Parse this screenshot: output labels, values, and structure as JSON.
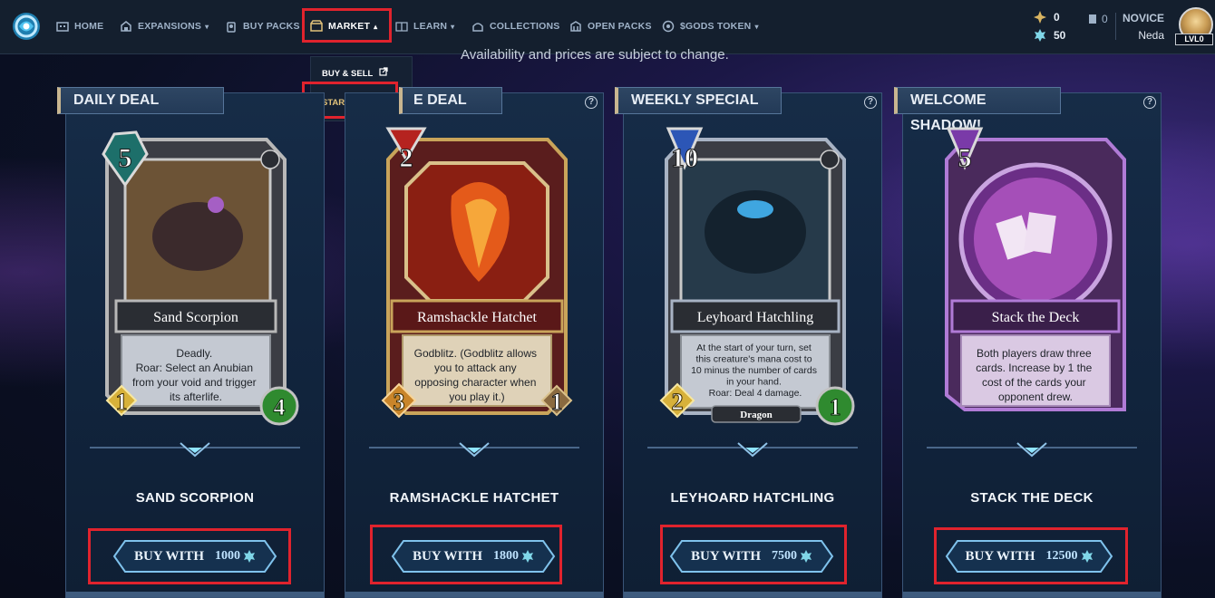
{
  "nav": {
    "items": [
      {
        "label": "HOME",
        "icon": "home-icon",
        "caret": ""
      },
      {
        "label": "EXPANSIONS",
        "icon": "expansions-icon",
        "caret": "▾"
      },
      {
        "label": "BUY PACKS",
        "icon": "buy-packs-icon",
        "caret": ""
      },
      {
        "label": "MARKET",
        "icon": "market-icon",
        "caret": "▴"
      },
      {
        "label": "LEARN",
        "icon": "learn-icon",
        "caret": "▾"
      },
      {
        "label": "COLLECTIONS",
        "icon": "collections-icon",
        "caret": ""
      },
      {
        "label": "OPEN PACKS",
        "icon": "open-packs-icon",
        "caret": ""
      },
      {
        "label": "$GODS TOKEN",
        "icon": "gods-token-icon",
        "caret": "▾"
      }
    ],
    "flux": "0",
    "stars": "50",
    "count": "0",
    "rank": "NOVICE",
    "username": "Neda",
    "level": "LVL0"
  },
  "market_menu": {
    "buy_sell": "BUY & SELL",
    "star_store": "STAR STORE"
  },
  "subtitle": "Availability and prices are subject to change.",
  "deals": [
    {
      "tag": "DAILY DEAL",
      "card_title": "Sand Scorpion",
      "mana": "5",
      "text": [
        "Deadly.",
        "Roar: Select an Anubian",
        "from your void and trigger",
        "its afterlife."
      ],
      "attack": "1",
      "health": "4",
      "tribe": "",
      "name": "SAND SCORPION",
      "buy_label": "BUY WITH",
      "price": "1000"
    },
    {
      "tag": "E DEAL",
      "card_title": "Ramshackle Hatchet",
      "mana": "2",
      "text": [
        "Godblitz. (Godblitz allows",
        "you to attack any",
        "opposing character when",
        "you play it.)"
      ],
      "attack": "3",
      "health": "1",
      "tribe": "",
      "name": "RAMSHACKLE HATCHET",
      "buy_label": "BUY WITH",
      "price": "1800"
    },
    {
      "tag": "WEEKLY SPECIAL",
      "card_title": "Leyhoard Hatchling",
      "mana": "10",
      "text": [
        "At the start of your turn, set",
        "this creature's mana cost to",
        "10 minus the number of cards",
        "in your hand.",
        "Roar: Deal 4 damage."
      ],
      "attack": "2",
      "health": "1",
      "tribe": "Dragon",
      "name": "LEYHOARD HATCHLING",
      "buy_label": "BUY WITH",
      "price": "7500"
    },
    {
      "tag": "WELCOME SHADOW!",
      "card_title": "Stack the Deck",
      "mana": "5",
      "text": [
        "Both players draw three",
        "cards. Increase by 1 the",
        "cost of the cards your",
        "opponent drew."
      ],
      "attack": "",
      "health": "",
      "tribe": "",
      "name": "STACK THE DECK",
      "buy_label": "BUY WITH",
      "price": "12500"
    }
  ],
  "colors": {
    "accent_red": "#e0232d",
    "gold": "#e2c27a",
    "panel": "#122640",
    "neutral_frame": "#b8b8b8",
    "war_frame": "#c9a45a",
    "magic_frame": "#a8b3c4",
    "deception_frame": "#b07bd6"
  }
}
